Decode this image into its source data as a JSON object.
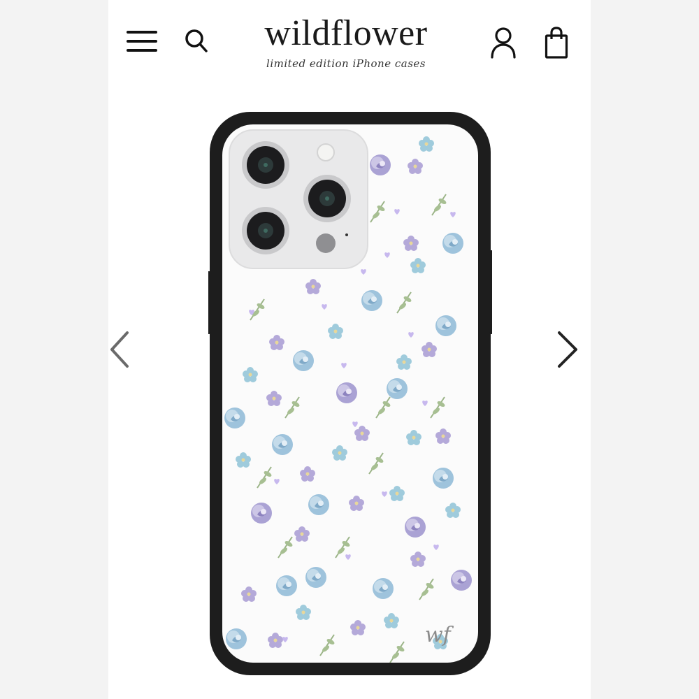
{
  "header": {
    "brand_name": "wildflower",
    "brand_tagline": "limited edition iPhone cases"
  },
  "product": {
    "case_logo": "wf"
  },
  "colors": {
    "case_frame": "#1d1d1d",
    "case_back": "#fbfbfb",
    "camera_module": "#e9e9ea",
    "flower_blue": "#a8c9dd",
    "flower_lavender": "#b7abd6",
    "leaf_green": "#9bb487",
    "arrow": "#6a6a6a"
  },
  "icons": {
    "menu": "menu-icon",
    "search": "search-icon",
    "account": "user-icon",
    "cart": "bag-icon",
    "prev": "chevron-left-icon",
    "next": "chevron-right-icon"
  }
}
